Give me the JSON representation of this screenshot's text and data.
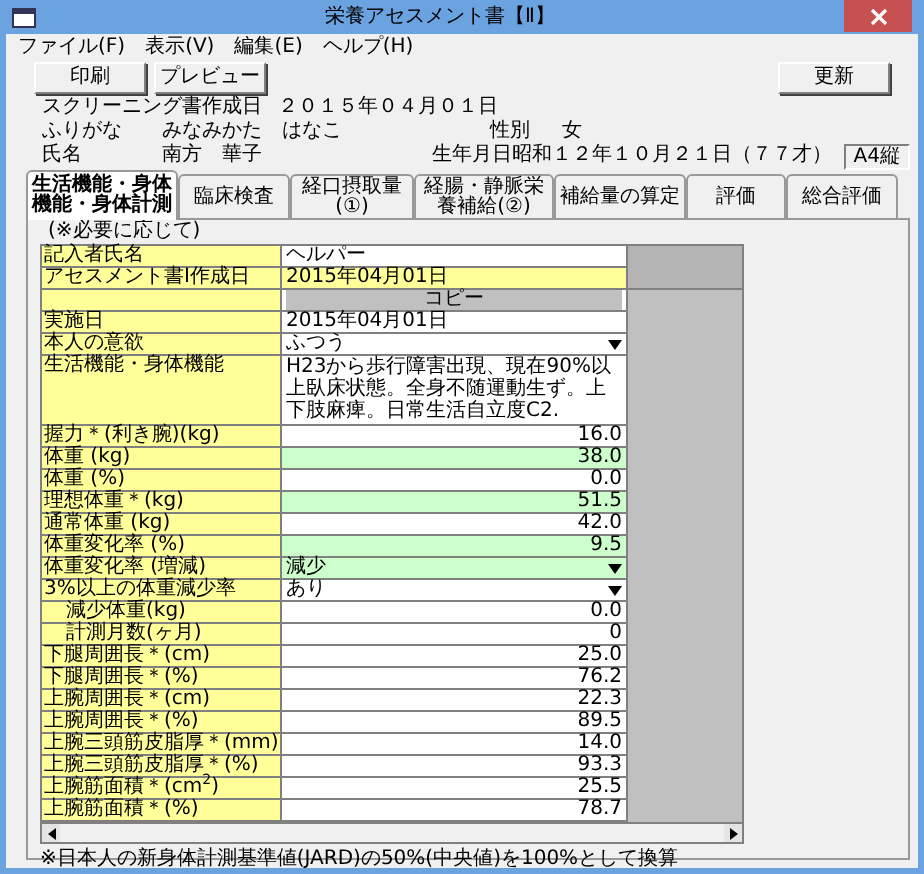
{
  "window": {
    "title": "栄養アセスメント書【Ⅱ】"
  },
  "menu": [
    "ファイル(F)",
    "表示(V)",
    "編集(E)",
    "ヘルプ(H)"
  ],
  "toolbar": {
    "left": [
      "印刷",
      "プレビュー"
    ],
    "right": [
      "更新"
    ]
  },
  "header": {
    "screening": {
      "label": "スクリーニング書作成日",
      "value": "２０１５年０４月０１日"
    },
    "furigana": {
      "label": "ふりがな",
      "value": "みなみかた　はなこ"
    },
    "sex": {
      "label": "性別",
      "value": "女"
    },
    "name": {
      "label": "氏名",
      "value": "南方　華子"
    },
    "birth": {
      "label": "生年月日",
      "value": "昭和１２年１０月２１日（７７才）"
    },
    "paper": "A4縦"
  },
  "tabs": [
    {
      "label": "生活機能・身体機能・身体計測",
      "selected": true
    },
    {
      "label": "臨床検査",
      "selected": false
    },
    {
      "label": "経口摂取量(①)",
      "selected": false
    },
    {
      "label": "経腸・静脈栄養補給(②)",
      "selected": false
    },
    {
      "label": "補給量の算定",
      "selected": false
    },
    {
      "label": "評価",
      "selected": false
    },
    {
      "label": "総合評価",
      "selected": false
    }
  ],
  "note": "(※必要に応じて)",
  "rows": [
    {
      "label": "記入者氏名",
      "value": "ヘルパー",
      "kind": "text",
      "color": "#ffffff"
    },
    {
      "label": "アセスメント書Ⅰ作成日",
      "value": "2015年04月01日",
      "kind": "text",
      "color": "#ffff99"
    },
    {
      "value": "コピー",
      "kind": "button",
      "color": "#c0c0c0"
    },
    {
      "label": "実施日",
      "value": "2015年04月01日",
      "kind": "text",
      "color": "#ffffff"
    },
    {
      "label": "本人の意欲",
      "value": "ふつう",
      "kind": "select",
      "color": "#ffffff"
    },
    {
      "label": "生活機能・身体機能",
      "value": "H23から歩行障害出現、現在90%以上臥床状態。全身不随運動生ず。上下肢麻痺。日常生活自立度C2.",
      "kind": "memo",
      "color": "#ffffff"
    },
    {
      "label": "握力＊(利き腕)(kg)",
      "value": "16.0",
      "kind": "number",
      "color": "#ffffff"
    },
    {
      "label": "体重 (kg)",
      "value": "38.0",
      "kind": "number",
      "color": "#ccffcc"
    },
    {
      "label": "体重 (%)",
      "value": "0.0",
      "kind": "number",
      "color": "#ffffff"
    },
    {
      "label": "理想体重＊(kg)",
      "value": "51.5",
      "kind": "number",
      "color": "#ccffcc"
    },
    {
      "label": "通常体重 (kg)",
      "value": "42.0",
      "kind": "number",
      "color": "#ffffff"
    },
    {
      "label": "体重変化率 (%)",
      "value": "9.5",
      "kind": "number",
      "color": "#ccffcc"
    },
    {
      "label": "体重変化率 (増減)",
      "value": "減少",
      "kind": "select",
      "color": "#ccffcc"
    },
    {
      "label": "3%以上の体重減少率",
      "value": "あり",
      "kind": "select",
      "color": "#ffffff",
      "children": [
        {
          "label": "減少体重(kg)",
          "value": "0.0",
          "kind": "number",
          "color": "#ffffff"
        },
        {
          "label": "計測月数(ヶ月)",
          "value": "0",
          "kind": "number",
          "color": "#ffffff"
        }
      ]
    },
    {
      "label": "下腿周囲長＊(cm)",
      "value": "25.0",
      "kind": "number",
      "color": "#ffffff"
    },
    {
      "label": "下腿周囲長＊(%)",
      "value": "76.2",
      "kind": "number",
      "color": "#ffffff"
    },
    {
      "label": "上腕周囲長＊(cm)",
      "value": "22.3",
      "kind": "number",
      "color": "#ffffff"
    },
    {
      "label": "上腕周囲長＊(%)",
      "value": "89.5",
      "kind": "number",
      "color": "#ffffff"
    },
    {
      "label": "上腕三頭筋皮脂厚＊(mm)",
      "value": "14.0",
      "kind": "number",
      "color": "#ffffff"
    },
    {
      "label": "上腕三頭筋皮脂厚＊(%)",
      "value": "93.3",
      "kind": "number",
      "color": "#ffffff"
    },
    {
      "label": "上腕筋面積＊(cm$^{2}$)",
      "value": "25.5",
      "kind": "number",
      "color": "#ffffff"
    },
    {
      "label": "上腕筋面積＊(%)",
      "value": "78.7",
      "kind": "number",
      "color": "#ffffff"
    }
  ],
  "footnote": "※日本人の新身体計測基準値(JARD)の50%(中央値)を100%として換算"
}
